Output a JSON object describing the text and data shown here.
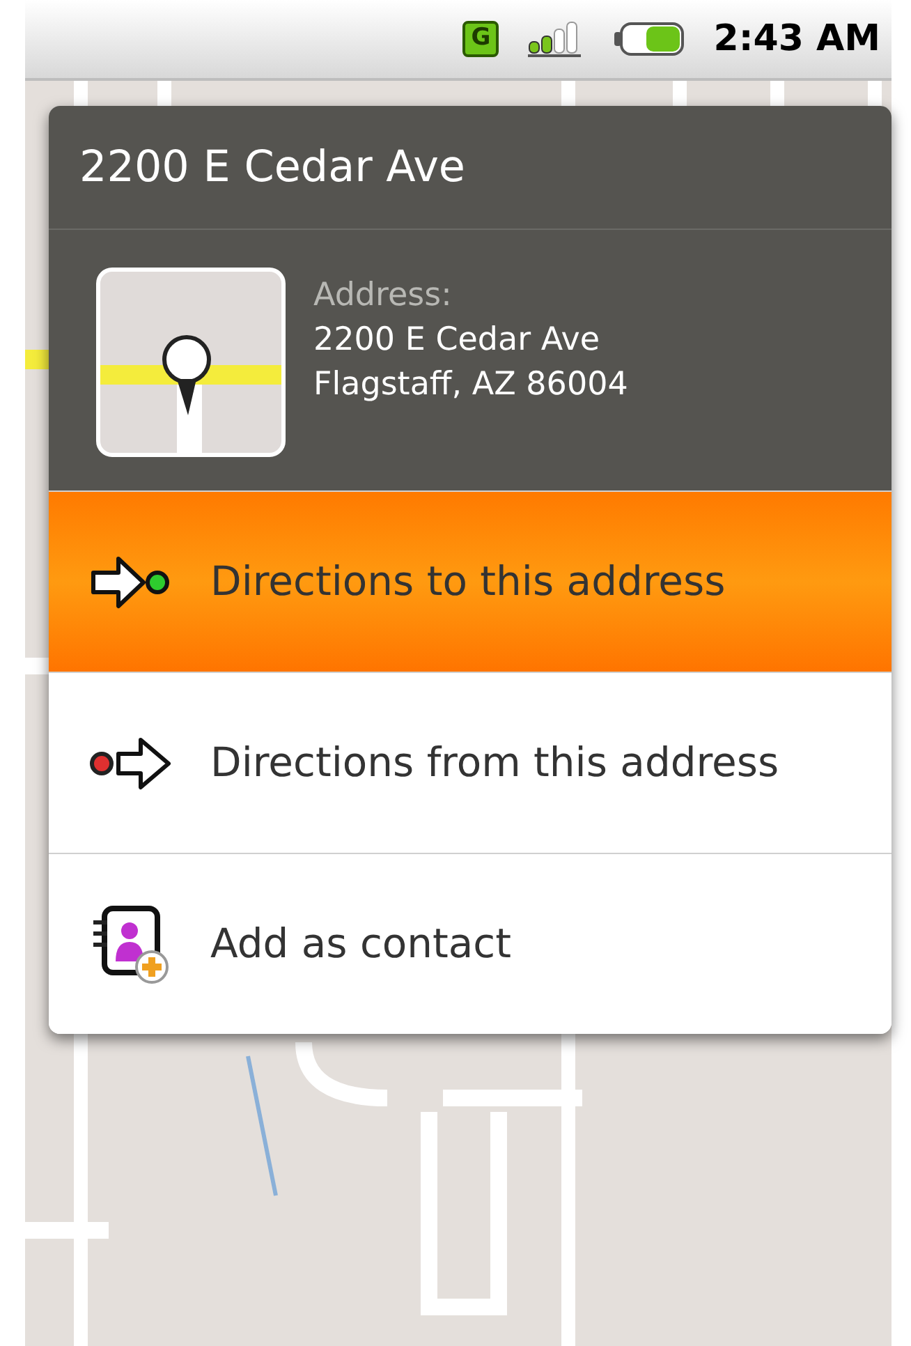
{
  "status_bar": {
    "time": "2:43 AM",
    "network": "G"
  },
  "dialog": {
    "title": "2200 E Cedar Ave",
    "address": {
      "label": "Address:",
      "lines": [
        "2200 E Cedar Ave",
        "Flagstaff, AZ 86004"
      ]
    },
    "items": [
      {
        "kind": "directions-to",
        "label": "Directions to this address",
        "selected": true
      },
      {
        "kind": "directions-from",
        "label": "Directions from this address",
        "selected": false
      },
      {
        "kind": "add-contact",
        "label": "Add as contact",
        "selected": false
      }
    ]
  }
}
